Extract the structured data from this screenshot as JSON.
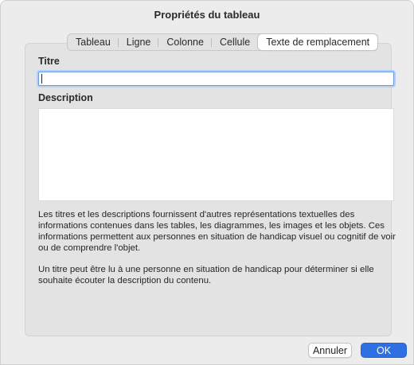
{
  "dialog": {
    "title": "Propriétés du tableau"
  },
  "tabs": [
    {
      "label": "Tableau",
      "active": false
    },
    {
      "label": "Ligne",
      "active": false
    },
    {
      "label": "Colonne",
      "active": false
    },
    {
      "label": "Cellule",
      "active": false
    },
    {
      "label": "Texte de remplacement",
      "active": true
    }
  ],
  "fields": {
    "title_label": "Titre",
    "title_value": "",
    "description_label": "Description",
    "description_value": ""
  },
  "help": {
    "paragraph1": "Les titres et les descriptions fournissent d'autres représentations textuelles des informations contenues dans les tables, les diagrammes, les images et les objets. Ces informations permettent aux personnes en situation de handicap visuel ou cognitif de voir ou de comprendre l'objet.",
    "paragraph2": "Un titre peut être lu à une personne en situation de handicap pour déterminer si elle souhaite écouter la description du contenu."
  },
  "buttons": {
    "cancel_label": "Annuler",
    "ok_label": "OK"
  },
  "colors": {
    "accent": "#2f6fe4",
    "focus_ring": "#b5cff3"
  }
}
